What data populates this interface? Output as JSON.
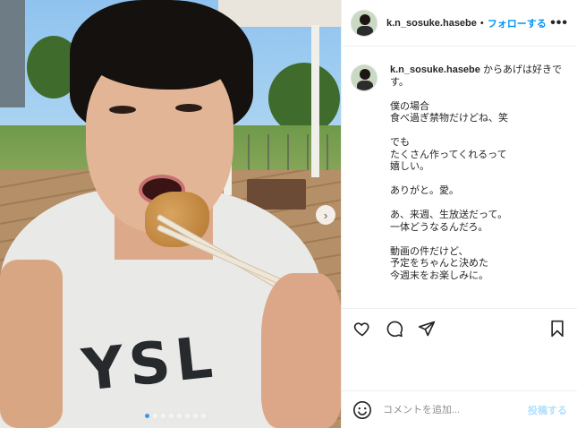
{
  "post": {
    "username": "k.n_sosuke.hasebe",
    "bullet": "•",
    "follow_label": "フォローする",
    "more_label": "•••",
    "next_label": "›",
    "shirt_print": "YSL",
    "carousel": {
      "count": 8,
      "active_index": 0
    }
  },
  "caption": {
    "username": "k.n_sosuke.hasebe",
    "first_line": " からあげは好きで",
    "lines": [
      "す。",
      "",
      "僕の場合",
      "食べ過ぎ禁物だけどね、笑",
      "",
      "でも",
      "たくさん作ってくれるって",
      "嬉しい。",
      "",
      "ありがと。愛。",
      "",
      "あ、来週、生放送だって。",
      "一体どうなるんだろ。",
      "",
      "動画の件だけど、",
      "予定をちゃんと決めた",
      "今週末をお楽しみに。"
    ]
  },
  "actions": {
    "like_icon": "heart-icon",
    "comment_icon": "speech-bubble-icon",
    "share_icon": "paper-plane-icon",
    "save_icon": "bookmark-icon"
  },
  "comment_box": {
    "emoji_icon": "smiley-icon",
    "placeholder": "コメントを追加...",
    "post_label": "投稿する",
    "post_color": "#b2dffc"
  },
  "colors": {
    "accent": "#0095f6",
    "text": "#262626",
    "border": "#efefef"
  }
}
